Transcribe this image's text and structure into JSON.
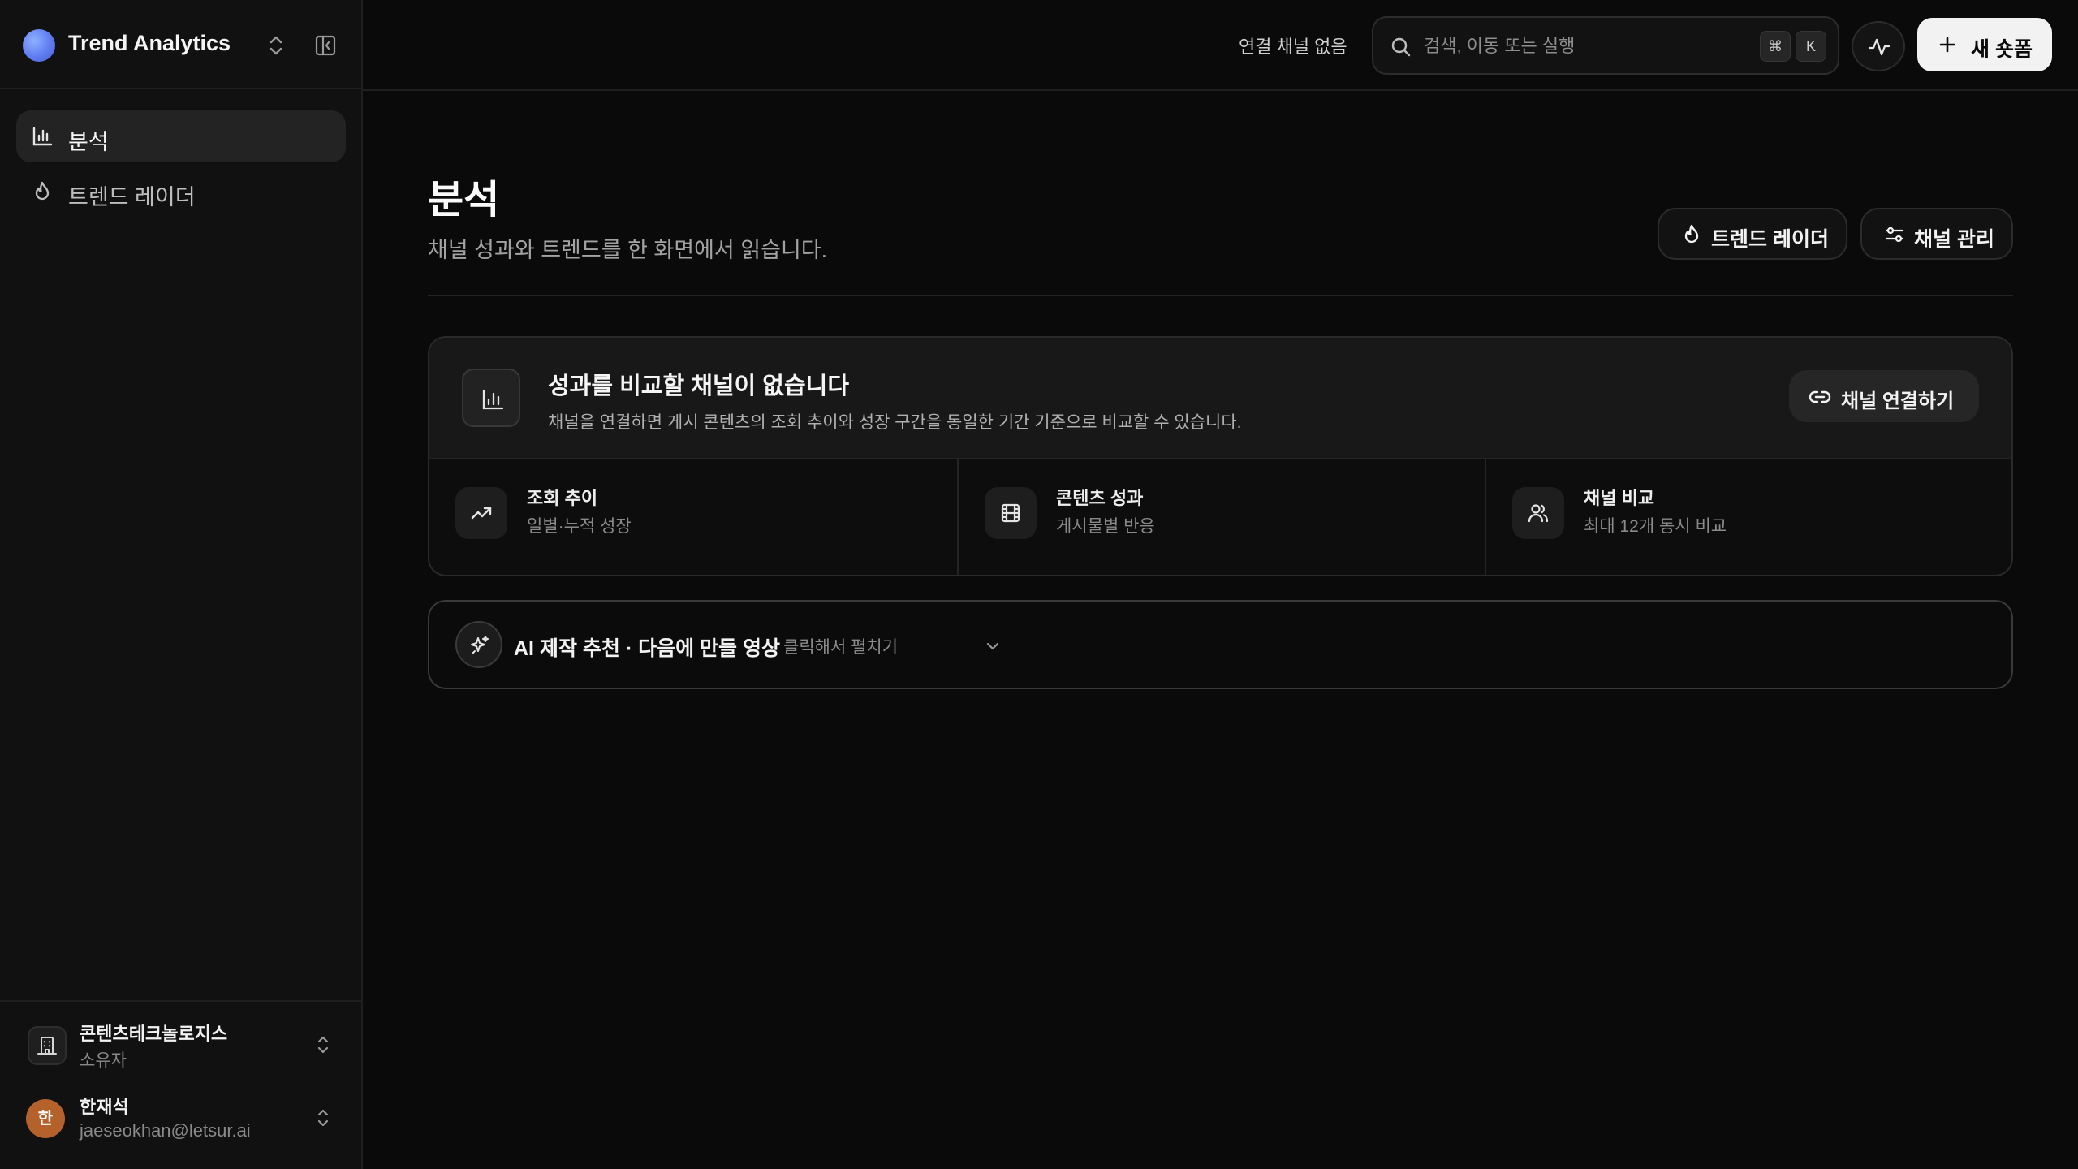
{
  "app": {
    "name": "Trend Analytics",
    "logo_color": "#6b8af7"
  },
  "sidebar": {
    "items": [
      {
        "label": "분석",
        "icon": "bar-chart-icon",
        "active": true
      },
      {
        "label": "트렌드 레이더",
        "icon": "flame-icon",
        "active": false
      }
    ],
    "workspace": {
      "name": "콘텐츠테크놀로지스",
      "role": "소유자",
      "icon": "building-icon"
    },
    "user": {
      "initial": "한",
      "name": "한재석",
      "email": "jaeseokhan@letsur.ai",
      "avatar_color": "#b5612b"
    }
  },
  "topbar": {
    "channel_status": "연결 채널 없음",
    "search": {
      "placeholder": "검색, 이동 또는 실행",
      "shortcut_keys": [
        "⌘",
        "K"
      ]
    },
    "activity_icon": "activity-icon",
    "new_button_label": "새 숏폼"
  },
  "page": {
    "title": "분석",
    "subtitle": "채널 성과와 트렌드를 한 화면에서 읽습니다.",
    "actions": [
      {
        "label": "트렌드 레이더",
        "icon": "flame-icon"
      },
      {
        "label": "채널 관리",
        "icon": "sliders-icon"
      }
    ]
  },
  "empty_state": {
    "title": "성과를 비교할 채널이 없습니다",
    "description": "채널을 연결하면 게시 콘텐츠의 조회 추이와 성장 구간을 동일한 기간 기준으로 비교할 수 있습니다.",
    "button_label": "채널 연결하기",
    "features": [
      {
        "title": "조회 추이",
        "subtitle": "일별·누적 성장",
        "icon": "trending-up-icon"
      },
      {
        "title": "콘텐츠 성과",
        "subtitle": "게시물별 반응",
        "icon": "film-icon"
      },
      {
        "title": "채널 비교",
        "subtitle": "최대 12개 동시 비교",
        "icon": "users-icon"
      }
    ]
  },
  "ai_panel": {
    "title": "AI 제작 추천 · 다음에 만들 영상",
    "hint": "클릭해서 펼치기",
    "expanded": false
  }
}
